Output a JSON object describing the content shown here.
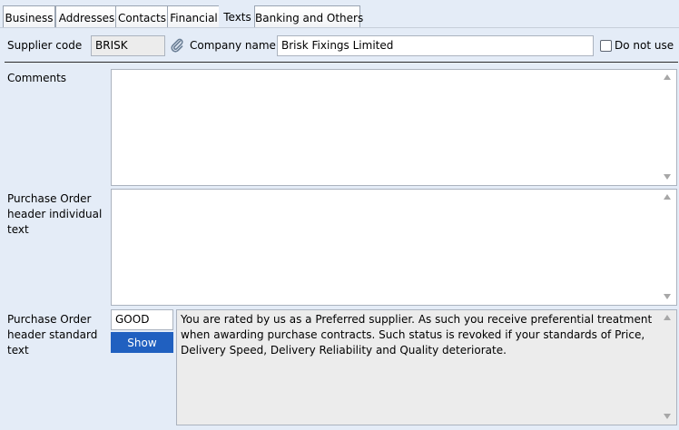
{
  "tabs": [
    {
      "label": "Business",
      "active": false
    },
    {
      "label": "Addresses",
      "active": false
    },
    {
      "label": "Contacts",
      "active": false
    },
    {
      "label": "Financial",
      "active": false
    },
    {
      "label": "Texts",
      "active": true
    },
    {
      "label": "Banking and Others",
      "active": false
    }
  ],
  "header": {
    "supplier_code_label": "Supplier code",
    "supplier_code_value": "BRISK",
    "attachment_icon": "paperclip-icon",
    "company_name_label": "Company name",
    "company_name_value": "Brisk Fixings Limited",
    "do_not_use_label": "Do not use",
    "do_not_use_checked": false
  },
  "comments": {
    "label": "Comments",
    "value": ""
  },
  "po_individual": {
    "label": "Purchase Order header individual text",
    "value": ""
  },
  "po_standard": {
    "label": "Purchase Order header standard text",
    "code_value": "GOOD",
    "show_button": "Show",
    "text": "You are rated by us as a Preferred supplier. As such you receive preferential treatment when awarding purchase contracts. Such status is revoked if your standards of Price, Delivery Speed, Delivery Reliability and Quality deteriorate."
  },
  "colors": {
    "background": "#e4ecf7",
    "button": "#2060c0",
    "readonly_field": "#ececec"
  }
}
